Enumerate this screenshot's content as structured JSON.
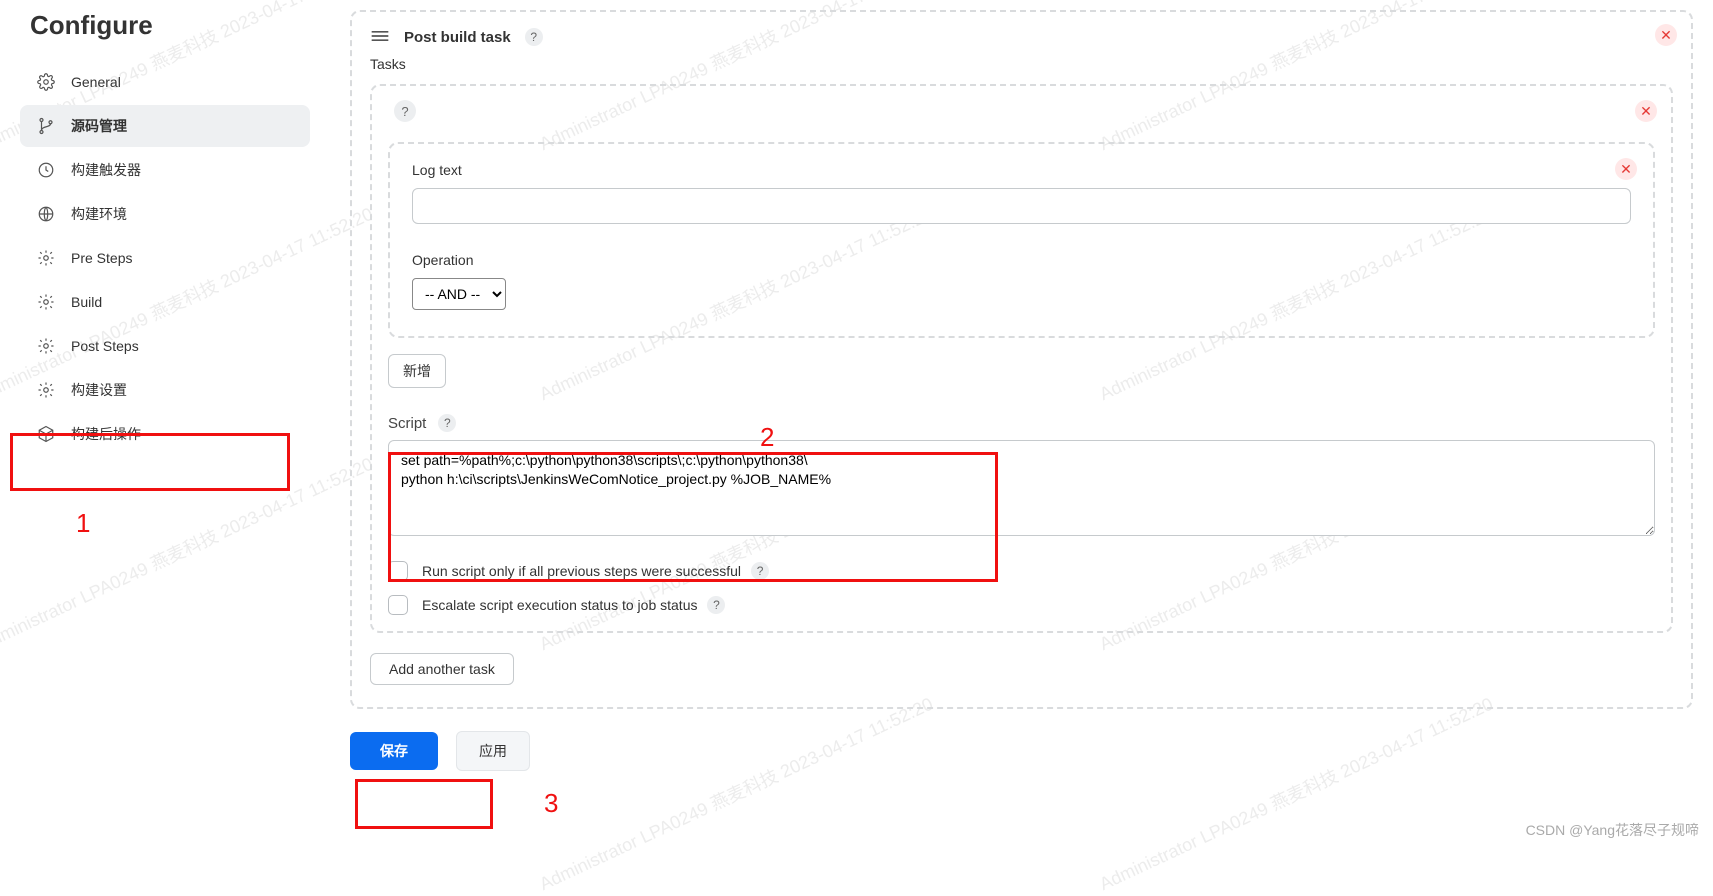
{
  "sidebar": {
    "title": "Configure",
    "items": [
      {
        "label": "General"
      },
      {
        "label": "源码管理"
      },
      {
        "label": "构建触发器"
      },
      {
        "label": "构建环境"
      },
      {
        "label": "Pre Steps"
      },
      {
        "label": "Build"
      },
      {
        "label": "Post Steps"
      },
      {
        "label": "构建设置"
      },
      {
        "label": "构建后操作"
      }
    ]
  },
  "section": {
    "title": "Post build task",
    "tasks_label": "Tasks",
    "log_text_label": "Log text",
    "log_text_value": "",
    "operation_label": "Operation",
    "operation_selected": "-- AND --",
    "add_new_label": "新增",
    "script_label": "Script",
    "script_value": "set path=%path%;c:\\python\\python38\\scripts\\;c:\\python\\python38\\\npython h:\\ci\\scripts\\JenkinsWeComNotice_project.py %JOB_NAME%",
    "check1_label": "Run script only if all previous steps were successful",
    "check2_label": "Escalate script execution status to job status",
    "add_another_label": "Add another task"
  },
  "footer": {
    "save_label": "保存",
    "apply_label": "应用"
  },
  "annotations": {
    "n1": "1",
    "n2": "2",
    "n3": "3"
  },
  "watermark": {
    "text": "Administrator  LPA0249  燕麦科技  2023-04-17  11:52:20"
  },
  "credit": "CSDN @Yang花落尽子规啼"
}
